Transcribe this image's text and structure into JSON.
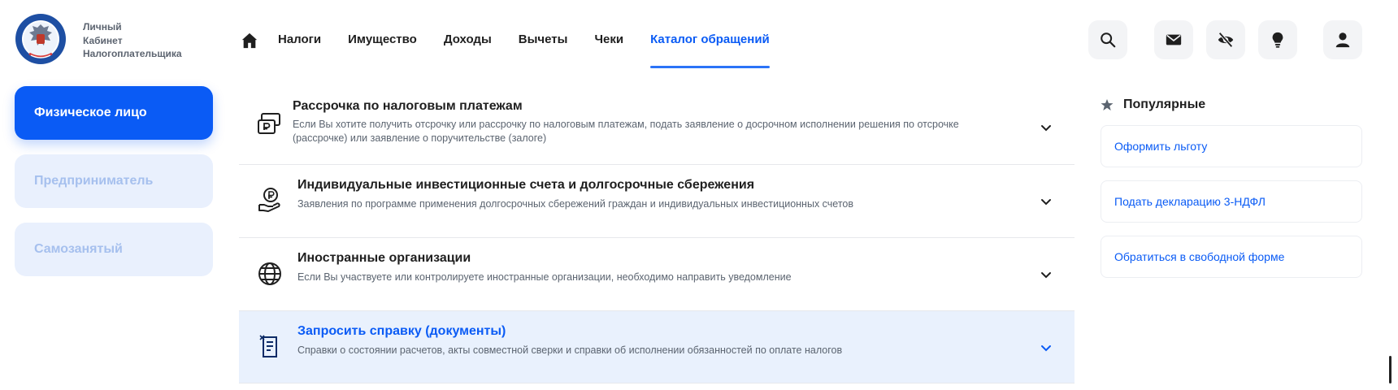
{
  "brand": {
    "line1": "Личный",
    "line2": "Кабинет",
    "line3": "Налогоплательщика"
  },
  "nav": {
    "home_icon": "home-icon",
    "items": [
      {
        "label": "Налоги"
      },
      {
        "label": "Имущество"
      },
      {
        "label": "Доходы"
      },
      {
        "label": "Вычеты"
      },
      {
        "label": "Чеки"
      },
      {
        "label": "Каталог обращений",
        "active": true
      }
    ]
  },
  "header_icons": [
    "search-icon",
    "mail-icon",
    "eye-off-icon",
    "lightbulb-icon",
    "user-icon"
  ],
  "sidebar": {
    "items": [
      {
        "label": "Физическое лицо",
        "active": true
      },
      {
        "label": "Предприниматель"
      },
      {
        "label": "Самозанятый"
      }
    ]
  },
  "catalog": {
    "items": [
      {
        "icon": "installment-icon",
        "title": "Рассрочка по налоговым платежам",
        "desc": "Если Вы хотите получить отсрочку или рассрочку по налоговым платежам, подать заявление о досрочном исполнении решения по отсрочке (рассрочке) или заявление о поручительстве (залоге)"
      },
      {
        "icon": "investment-icon",
        "title": "Индивидуальные инвестиционные счета и долгосрочные сбережения",
        "desc": "Заявления по программе применения долгосрочных сбережений граждан и индивидуальных инвестиционных счетов"
      },
      {
        "icon": "globe-icon",
        "title": "Иностранные организации",
        "desc": "Если Вы участвуете или контролируете иностранные организации, необходимо направить уведомление"
      },
      {
        "icon": "document-request-icon",
        "title": "Запросить справку (документы)",
        "desc": "Справки о состоянии расчетов, акты совместной сверки и справки об исполнении обязанностей по оплате налогов"
      }
    ]
  },
  "popular": {
    "title": "Популярные",
    "links": [
      {
        "label": "Оформить льготу"
      },
      {
        "label": "Подать декларацию 3-НДФЛ"
      },
      {
        "label": "Обратиться в свободной форме"
      }
    ]
  },
  "colors": {
    "accent": "#0a5bf5",
    "sidebar_inactive_bg": "#e9f0fd",
    "highlight_row_bg": "#e9f1fd"
  }
}
